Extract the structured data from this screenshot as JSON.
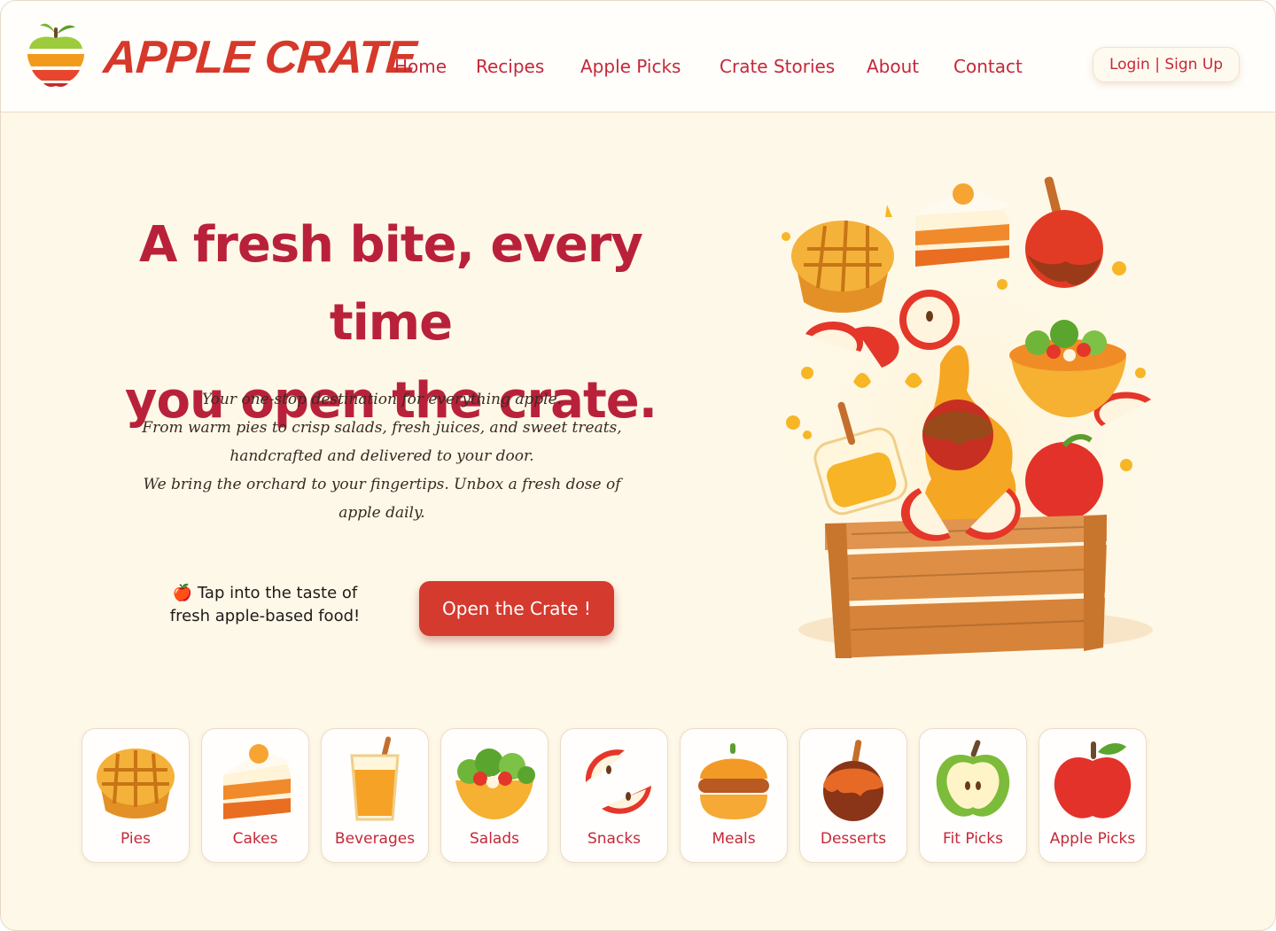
{
  "header": {
    "brand": "APPLE CRATE",
    "nav": [
      "Home",
      "Recipes",
      "Apple Picks",
      "Crate Stories",
      "About",
      "Contact"
    ],
    "auth": "Login | Sign Up"
  },
  "hero": {
    "title_line1": "A fresh bite, every time",
    "title_line2": "you open the crate.",
    "desc": [
      "Your one-stop destination for everything apple.",
      "From warm pies to crisp salads, fresh juices, and sweet treats,",
      "handcrafted and delivered to your door.",
      "We bring the orchard to your fingertips. Unbox a fresh dose of",
      "apple daily."
    ],
    "tap_line1": "🍎 Tap into the taste of",
    "tap_line2": "fresh apple-based food!",
    "cta": "Open the Crate !"
  },
  "categories": [
    {
      "label": "Pies",
      "icon": "pie-icon"
    },
    {
      "label": "Cakes",
      "icon": "cake-icon"
    },
    {
      "label": "Beverages",
      "icon": "juice-icon"
    },
    {
      "label": "Salads",
      "icon": "salad-icon"
    },
    {
      "label": "Snacks",
      "icon": "apple-slices-icon"
    },
    {
      "label": "Meals",
      "icon": "burger-icon"
    },
    {
      "label": "Desserts",
      "icon": "caramel-apple-icon"
    },
    {
      "label": "Fit Picks",
      "icon": "green-apple-icon"
    },
    {
      "label": "Apple Picks",
      "icon": "red-apple-icon"
    }
  ],
  "colors": {
    "brand": "#d6382a",
    "title": "#b9213a",
    "nav": "#c4283a",
    "cta": "#d43a2e",
    "background": "#fef8e8"
  }
}
